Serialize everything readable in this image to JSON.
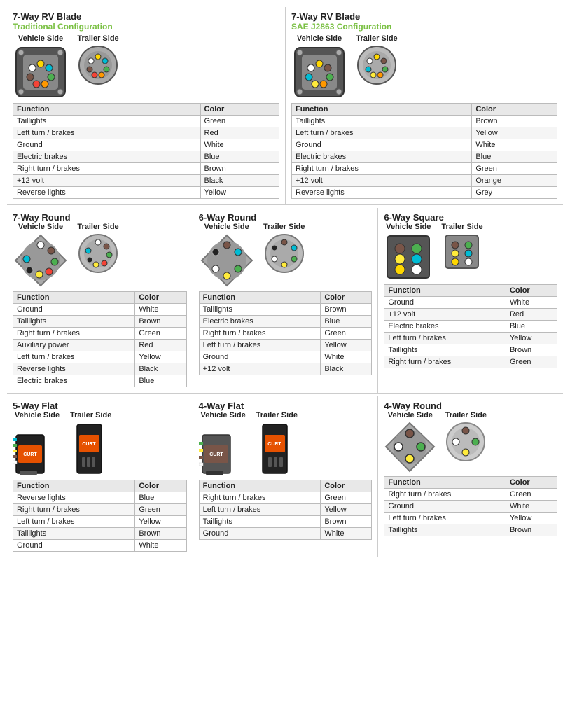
{
  "sections": {
    "rv_blade_traditional": {
      "title": "7-Way RV Blade",
      "subtitle": "Traditional Configuration",
      "vehicle_label": "Vehicle Side",
      "trailer_label": "Trailer Side",
      "table_headers": [
        "Function",
        "Color"
      ],
      "rows": [
        [
          "Taillights",
          "Green"
        ],
        [
          "Left turn / brakes",
          "Red"
        ],
        [
          "Ground",
          "White"
        ],
        [
          "Electric brakes",
          "Blue"
        ],
        [
          "Right turn / brakes",
          "Brown"
        ],
        [
          "+12 volt",
          "Black"
        ],
        [
          "Reverse lights",
          "Yellow"
        ]
      ]
    },
    "rv_blade_sae": {
      "title": "7-Way RV Blade",
      "subtitle": "SAE J2863 Configuration",
      "vehicle_label": "Vehicle Side",
      "trailer_label": "Trailer Side",
      "table_headers": [
        "Function",
        "Color"
      ],
      "rows": [
        [
          "Taillights",
          "Brown"
        ],
        [
          "Left turn / brakes",
          "Yellow"
        ],
        [
          "Ground",
          "White"
        ],
        [
          "Electric brakes",
          "Blue"
        ],
        [
          "Right turn / brakes",
          "Green"
        ],
        [
          "+12 volt",
          "Orange"
        ],
        [
          "Reverse lights",
          "Grey"
        ]
      ]
    },
    "round_7way": {
      "title": "7-Way Round",
      "vehicle_label": "Vehicle Side",
      "trailer_label": "Trailer Side",
      "table_headers": [
        "Function",
        "Color"
      ],
      "rows": [
        [
          "Ground",
          "White"
        ],
        [
          "Taillights",
          "Brown"
        ],
        [
          "Right turn / brakes",
          "Green"
        ],
        [
          "Auxiliary power",
          "Red"
        ],
        [
          "Left turn / brakes",
          "Yellow"
        ],
        [
          "Reverse lights",
          "Black"
        ],
        [
          "Electric brakes",
          "Blue"
        ]
      ]
    },
    "round_6way": {
      "title": "6-Way Round",
      "vehicle_label": "Vehicle Side",
      "trailer_label": "Trailer Side",
      "table_headers": [
        "Function",
        "Color"
      ],
      "rows": [
        [
          "Taillights",
          "Brown"
        ],
        [
          "Electric brakes",
          "Blue"
        ],
        [
          "Right turn / brakes",
          "Green"
        ],
        [
          "Left turn / brakes",
          "Yellow"
        ],
        [
          "Ground",
          "White"
        ],
        [
          "+12 volt",
          "Black"
        ]
      ]
    },
    "square_6way": {
      "title": "6-Way Square",
      "vehicle_label": "Vehicle Side",
      "trailer_label": "Trailer Side",
      "table_headers": [
        "Function",
        "Color"
      ],
      "rows": [
        [
          "Ground",
          "White"
        ],
        [
          "+12 volt",
          "Red"
        ],
        [
          "Electric brakes",
          "Blue"
        ],
        [
          "Left turn / brakes",
          "Yellow"
        ],
        [
          "Taillights",
          "Brown"
        ],
        [
          "Right turn / brakes",
          "Green"
        ]
      ]
    },
    "flat_5way": {
      "title": "5-Way Flat",
      "vehicle_label": "Vehicle Side",
      "trailer_label": "Trailer Side",
      "table_headers": [
        "Function",
        "Color"
      ],
      "rows": [
        [
          "Reverse lights",
          "Blue"
        ],
        [
          "Right turn / brakes",
          "Green"
        ],
        [
          "Left turn / brakes",
          "Yellow"
        ],
        [
          "Taillights",
          "Brown"
        ],
        [
          "Ground",
          "White"
        ]
      ]
    },
    "flat_4way": {
      "title": "4-Way Flat",
      "vehicle_label": "Vehicle Side",
      "trailer_label": "Trailer Side",
      "table_headers": [
        "Function",
        "Color"
      ],
      "rows": [
        [
          "Right turn / brakes",
          "Green"
        ],
        [
          "Left turn / brakes",
          "Yellow"
        ],
        [
          "Taillights",
          "Brown"
        ],
        [
          "Ground",
          "White"
        ]
      ]
    },
    "round_4way": {
      "title": "4-Way Round",
      "vehicle_label": "Vehicle Side",
      "trailer_label": "Trailer Side",
      "table_headers": [
        "Function",
        "Color"
      ],
      "rows": [
        [
          "Right turn / brakes",
          "Green"
        ],
        [
          "Ground",
          "White"
        ],
        [
          "Left turn / brakes",
          "Yellow"
        ],
        [
          "Taillights",
          "Brown"
        ]
      ]
    }
  }
}
